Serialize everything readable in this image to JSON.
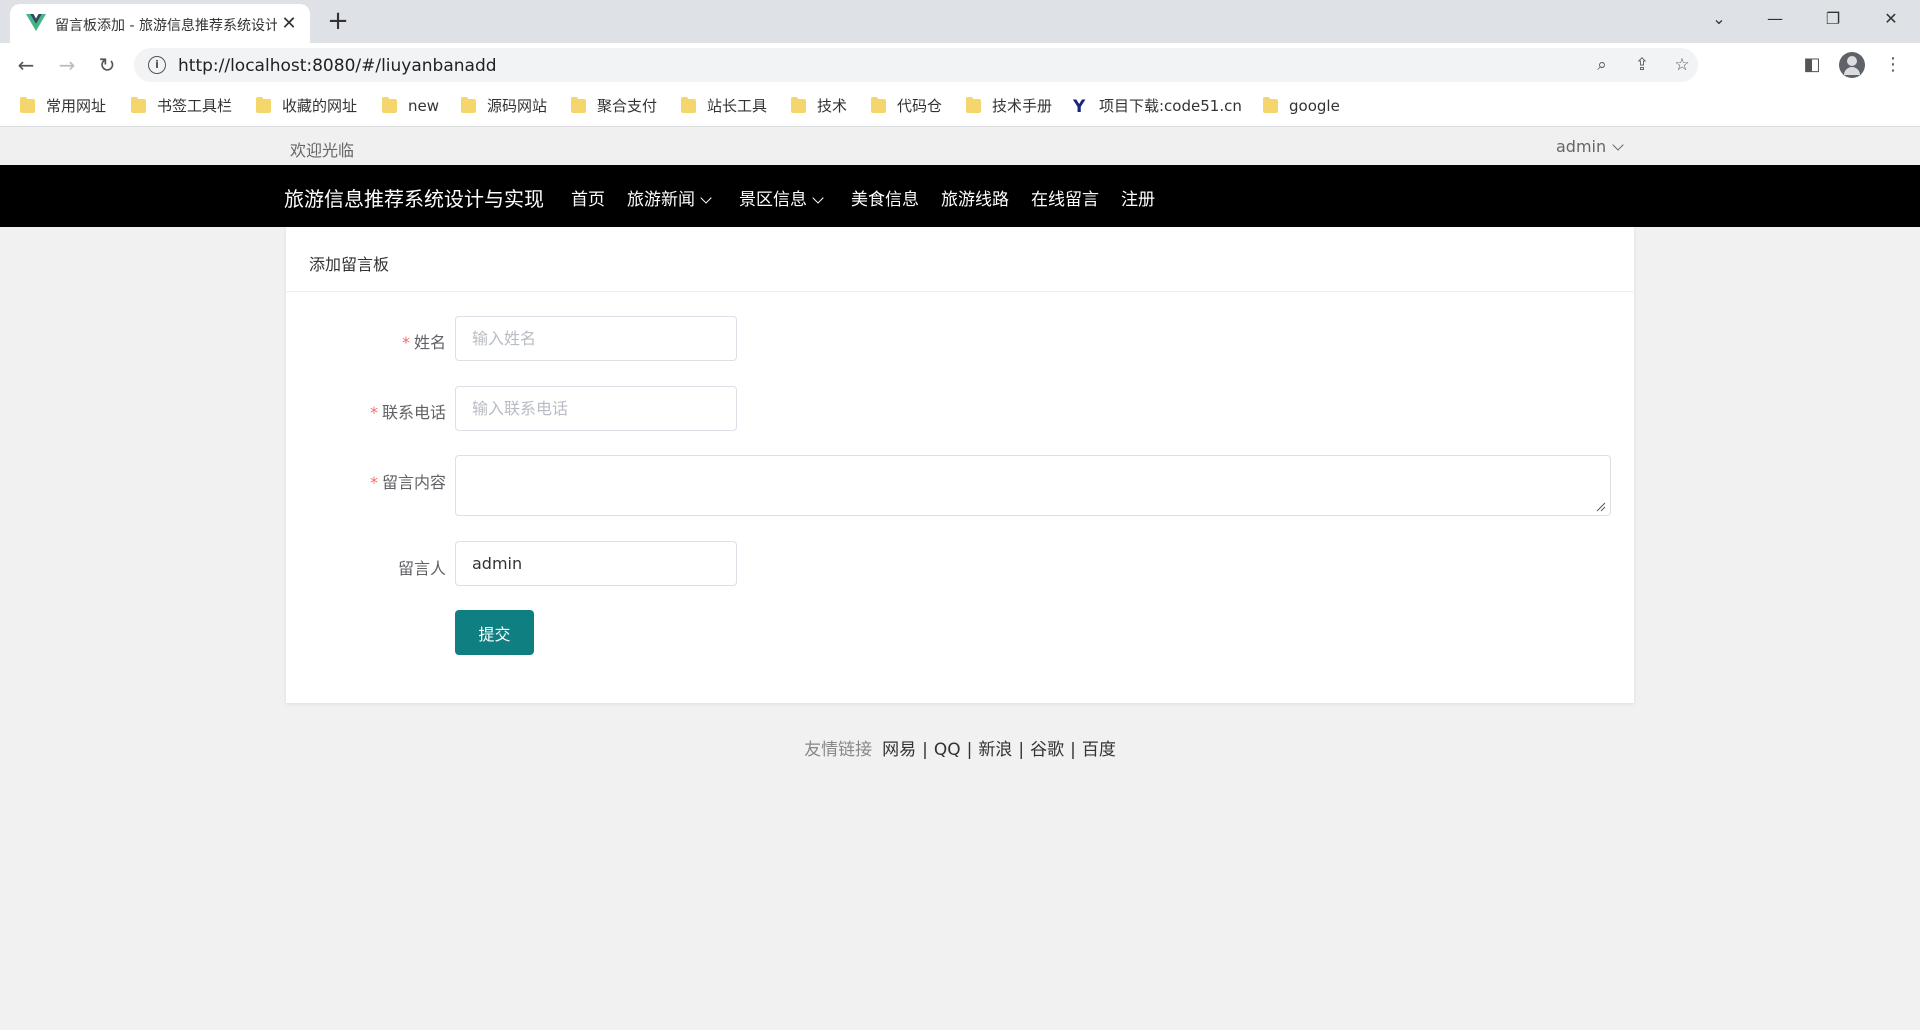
{
  "browser": {
    "tab_title": "留言板添加 - 旅游信息推荐系统设计与实现",
    "url": "http://localhost:8080/#/liuyanbanadd",
    "bookmarks": [
      {
        "label": "常用网址",
        "icon": "folder-icon"
      },
      {
        "label": "书签工具栏",
        "icon": "folder-icon"
      },
      {
        "label": "收藏的网址",
        "icon": "folder-icon"
      },
      {
        "label": "new",
        "icon": "folder-icon"
      },
      {
        "label": "源码网站",
        "icon": "folder-icon"
      },
      {
        "label": "聚合支付",
        "icon": "folder-icon"
      },
      {
        "label": "站长工具",
        "icon": "folder-icon"
      },
      {
        "label": "技术",
        "icon": "folder-icon"
      },
      {
        "label": "代码仓",
        "icon": "folder-icon"
      },
      {
        "label": "技术手册",
        "icon": "folder-icon"
      },
      {
        "label": "项目下载:code51.cn",
        "icon": "site-logo-icon"
      },
      {
        "label": "google",
        "icon": "folder-icon"
      }
    ]
  },
  "topbar": {
    "welcome": "欢迎光临",
    "user": "admin"
  },
  "nav": {
    "brand": "旅游信息推荐系统设计与实现",
    "items": [
      {
        "label": "首页",
        "dropdown": false
      },
      {
        "label": "旅游新闻",
        "dropdown": true
      },
      {
        "label": "景区信息",
        "dropdown": true
      },
      {
        "label": "美食信息",
        "dropdown": false
      },
      {
        "label": "旅游线路",
        "dropdown": false
      },
      {
        "label": "在线留言",
        "dropdown": false
      },
      {
        "label": "注册",
        "dropdown": false
      }
    ]
  },
  "form": {
    "title": "添加留言板",
    "required_mark": "*",
    "fields": {
      "name": {
        "label": "姓名",
        "placeholder": "输入姓名",
        "value": "",
        "required": true
      },
      "phone": {
        "label": "联系电话",
        "placeholder": "输入联系电话",
        "value": "",
        "required": true
      },
      "content": {
        "label": "留言内容",
        "placeholder": "",
        "value": "",
        "required": true
      },
      "author": {
        "label": "留言人",
        "placeholder": "",
        "value": "admin",
        "required": false
      }
    },
    "submit_label": "提交"
  },
  "footer": {
    "label": "友情链接",
    "links": [
      "网易",
      "QQ",
      "新浪",
      "谷歌",
      "百度"
    ],
    "separator": "|"
  },
  "colors": {
    "navbar_bg": "#000000",
    "submit_bg": "#0f7f82",
    "required": "#f56c6c",
    "page_bg": "#f1f1f1"
  }
}
